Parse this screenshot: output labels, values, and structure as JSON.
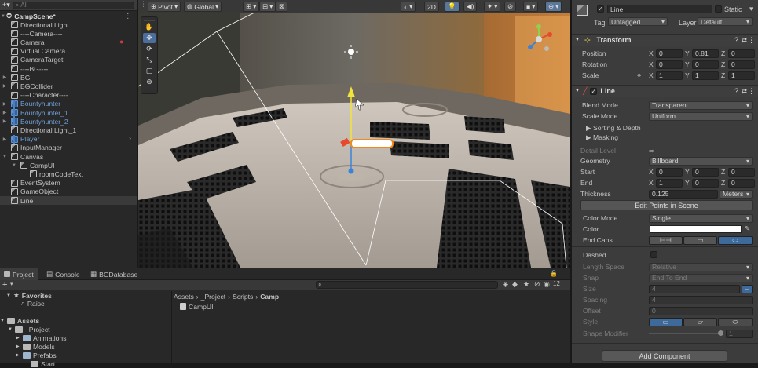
{
  "hierarchy": {
    "search_placeholder": "All",
    "scene_name": "CampScene*",
    "items": [
      {
        "label": "Directional Light",
        "depth": 1,
        "prefab": false,
        "arrow": ""
      },
      {
        "label": "----Camera----",
        "depth": 1,
        "prefab": false,
        "arrow": ""
      },
      {
        "label": "Camera",
        "depth": 1,
        "prefab": false,
        "arrow": ""
      },
      {
        "label": "Virtual Camera",
        "depth": 1,
        "prefab": false,
        "arrow": ""
      },
      {
        "label": "CameraTarget",
        "depth": 1,
        "prefab": false,
        "arrow": ""
      },
      {
        "label": "----BG----",
        "depth": 1,
        "prefab": false,
        "arrow": ""
      },
      {
        "label": "BG",
        "depth": 1,
        "prefab": false,
        "arrow": "▶"
      },
      {
        "label": "BGCollider",
        "depth": 1,
        "prefab": false,
        "arrow": "▶"
      },
      {
        "label": "----Character----",
        "depth": 1,
        "prefab": false,
        "arrow": ""
      },
      {
        "label": "Bountyhunter",
        "depth": 1,
        "prefab": true,
        "arrow": "▶"
      },
      {
        "label": "Bountyhunter_1",
        "depth": 1,
        "prefab": true,
        "arrow": "▶"
      },
      {
        "label": "Bountyhunter_2",
        "depth": 1,
        "prefab": true,
        "arrow": "▶"
      },
      {
        "label": "Directional Light_1",
        "depth": 1,
        "prefab": false,
        "arrow": ""
      },
      {
        "label": "Player",
        "depth": 1,
        "prefab": true,
        "arrow": "▶"
      },
      {
        "label": "InputManager",
        "depth": 1,
        "prefab": false,
        "arrow": ""
      },
      {
        "label": "Canvas",
        "depth": 1,
        "prefab": false,
        "arrow": "▼"
      },
      {
        "label": "CampUI",
        "depth": 2,
        "prefab": false,
        "arrow": "▼"
      },
      {
        "label": "roomCodeText",
        "depth": 3,
        "prefab": false,
        "arrow": ""
      },
      {
        "label": "EventSystem",
        "depth": 1,
        "prefab": false,
        "arrow": ""
      },
      {
        "label": "GameObject",
        "depth": 1,
        "prefab": false,
        "arrow": ""
      },
      {
        "label": "Line",
        "depth": 1,
        "prefab": false,
        "arrow": "",
        "selected": true
      }
    ]
  },
  "scene_toolbar": {
    "pivot": "Pivot",
    "global": "Global",
    "mode_2d": "2D"
  },
  "inspector": {
    "object_name": "Line",
    "static_label": "Static",
    "tag_label": "Tag",
    "tag_value": "Untagged",
    "layer_label": "Layer",
    "layer_value": "Default",
    "transform": {
      "title": "Transform",
      "position_label": "Position",
      "rotation_label": "Rotation",
      "scale_label": "Scale",
      "position": {
        "x": "0",
        "y": "0.81",
        "z": "0"
      },
      "rotation": {
        "x": "0",
        "y": "0",
        "z": "0"
      },
      "scale": {
        "x": "1",
        "y": "1",
        "z": "1"
      }
    },
    "line": {
      "title": "Line",
      "blend_mode_label": "Blend Mode",
      "blend_mode": "Transparent",
      "scale_mode_label": "Scale Mode",
      "scale_mode": "Uniform",
      "sorting": "Sorting & Depth",
      "masking": "Masking",
      "detail_level_label": "Detail Level",
      "detail_level": "∞",
      "geometry_label": "Geometry",
      "geometry": "Billboard",
      "start_label": "Start",
      "start": {
        "x": "0",
        "y": "0",
        "z": "0"
      },
      "end_label": "End",
      "end": {
        "x": "1",
        "y": "0",
        "z": "0"
      },
      "thickness_label": "Thickness",
      "thickness": "0.125",
      "thickness_unit": "Meters",
      "edit_points": "Edit Points in Scene",
      "color_mode_label": "Color Mode",
      "color_mode": "Single",
      "color_label": "Color",
      "color_value": "#ffffff",
      "end_caps_label": "End Caps",
      "dashed_label": "Dashed",
      "length_space_label": "Length Space",
      "length_space": "Relative",
      "snap_label": "Snap",
      "snap": "End To End",
      "size_label": "Size",
      "size": "4",
      "spacing_label": "Spacing",
      "spacing": "4",
      "offset_label": "Offset",
      "offset": "0",
      "style_label": "Style",
      "shape_modifier_label": "Shape Modifier",
      "shape_modifier": "1"
    },
    "add_component": "Add Component"
  },
  "bottom": {
    "tabs": [
      "Project",
      "Console",
      "BGDatabase"
    ],
    "favorites": "Favorites",
    "favorites_items": [
      "Raise"
    ],
    "assets": "Assets",
    "tree": [
      "_Project",
      "Animations",
      "Models",
      "Prefabs",
      "Start"
    ],
    "breadcrumb": [
      "Assets",
      "_Project",
      "Scripts",
      "Camp"
    ],
    "files": [
      "CampUI"
    ],
    "count": "12",
    "plus": "+"
  },
  "colors": {
    "accent": "#4b7fc4",
    "prefab_text": "#6f9fd9",
    "selection": "#3a3a3a"
  }
}
